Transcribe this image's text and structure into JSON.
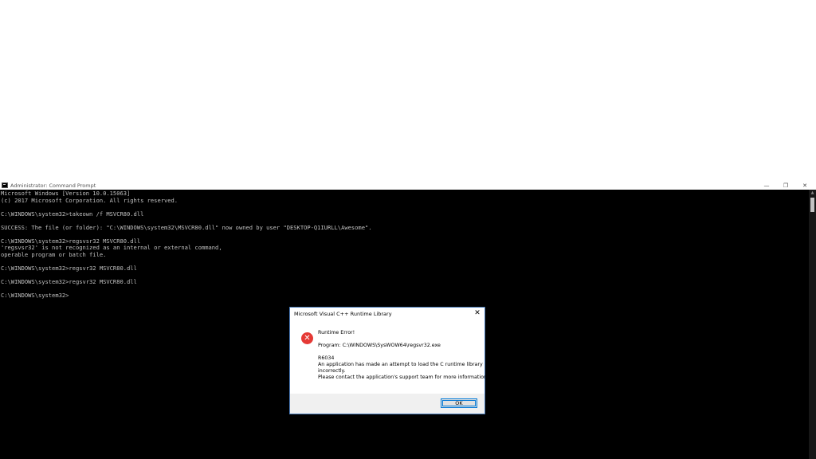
{
  "console": {
    "title": "Administrator: Command Prompt",
    "lines": [
      "Microsoft Windows [Version 10.0.15063]",
      "(c) 2017 Microsoft Corporation. All rights reserved.",
      "",
      "C:\\WINDOWS\\system32>takeown /f MSVCR80.dll",
      "",
      "SUCCESS: The file (or folder): \"C:\\WINDOWS\\system32\\MSVCR80.dll\" now owned by user \"DESKTOP-Q1IURLL\\Awesome\".",
      "",
      "C:\\WINDOWS\\system32>regsvsr32 MSVCR80.dll",
      "'regsvsr32' is not recognized as an internal or external command,",
      "operable program or batch file.",
      "",
      "C:\\WINDOWS\\system32>regsvr32 MSVCR80.dll",
      "",
      "C:\\WINDOWS\\system32>regsvr32 MSVCR80.dll",
      "",
      "C:\\WINDOWS\\system32>"
    ],
    "controls": {
      "minimize": "—",
      "maximize": "❐",
      "close": "✕"
    }
  },
  "dialog": {
    "title": "Microsoft Visual C++ Runtime Library",
    "close": "✕",
    "heading": "Runtime Error!",
    "program": "Program: C:\\WINDOWS\\SysWOW64\\regsvr32.exe",
    "code": "R6034",
    "message_line1": "An application has made an attempt to load the C runtime library",
    "message_line2": "incorrectly.",
    "message_line3": "Please contact the application's support team for more information.",
    "ok_label": "OK",
    "icon": "error-icon",
    "icon_glyph": "✕"
  },
  "colors": {
    "console_bg": "#000000",
    "console_text": "#c0c0c0",
    "error_red": "#e53935",
    "accent": "#0078d7"
  }
}
